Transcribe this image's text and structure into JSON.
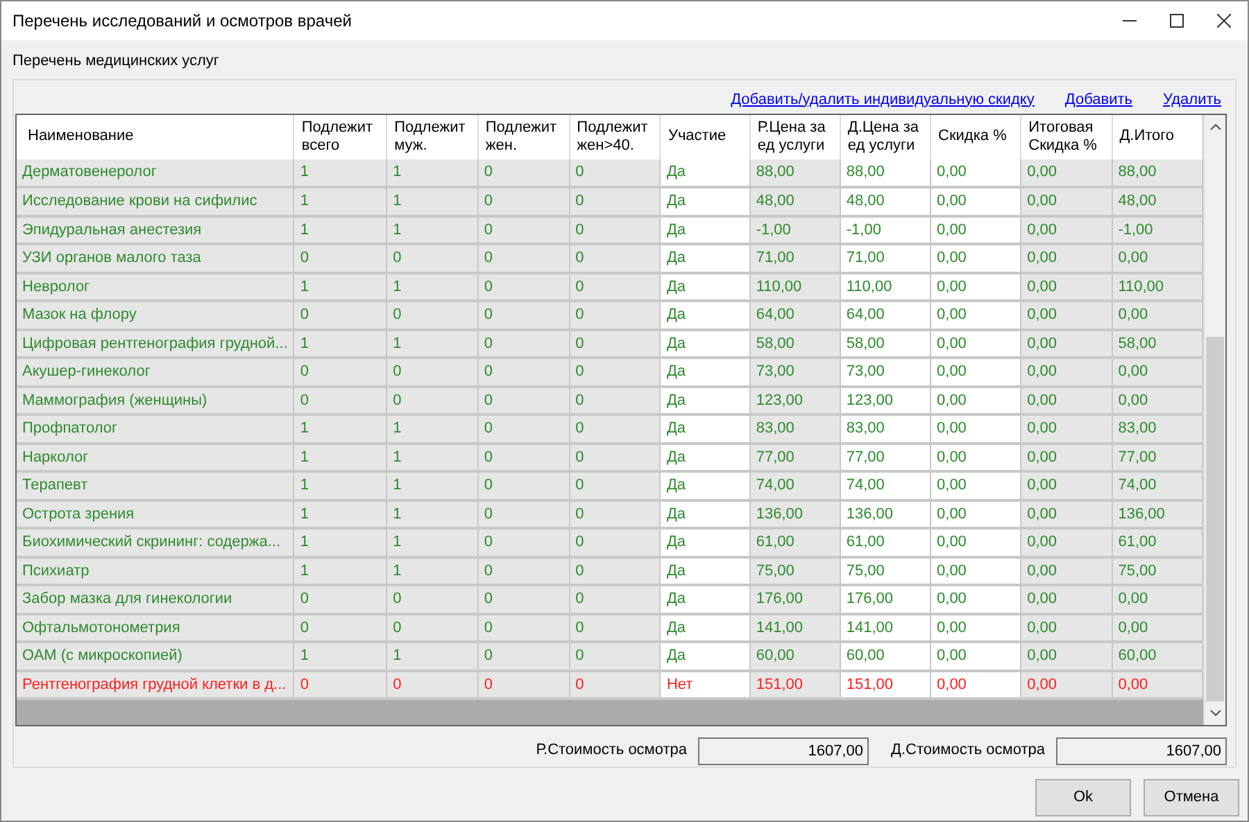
{
  "window": {
    "title": "Перечень исследований и осмотров врачей"
  },
  "section_label": "Перечень медицинских услуг",
  "links": [
    "Добавить/удалить индивидуальную скидку",
    "Добавить",
    "Удалить"
  ],
  "table": {
    "columns": [
      {
        "label": "Наименование",
        "editable": false
      },
      {
        "label": "Подлежит всего",
        "editable": false
      },
      {
        "label": "Подлежит муж.",
        "editable": false
      },
      {
        "label": "Подлежит жен.",
        "editable": false
      },
      {
        "label": "Подлежит жен>40.",
        "editable": false
      },
      {
        "label": "Участие",
        "editable": true
      },
      {
        "label": "Р.Цена за ед услуги",
        "editable": false
      },
      {
        "label": "Д.Цена за ед услуги",
        "editable": true
      },
      {
        "label": "Скидка %",
        "editable": true
      },
      {
        "label": "Итоговая Скидка %",
        "editable": false
      },
      {
        "label": "Д.Итого",
        "editable": false
      }
    ],
    "rows": [
      {
        "color": "#2e8b2e",
        "cells": [
          "Дерматовенеролог",
          "1",
          "1",
          "0",
          "0",
          "Да",
          "88,00",
          "88,00",
          "0,00",
          "0,00",
          "88,00"
        ]
      },
      {
        "color": "#2e8b2e",
        "cells": [
          "Исследование крови на сифилис",
          "1",
          "1",
          "0",
          "0",
          "Да",
          "48,00",
          "48,00",
          "0,00",
          "0,00",
          "48,00"
        ]
      },
      {
        "color": "#2e8b2e",
        "cells": [
          "Эпидуральная анестезия",
          "1",
          "1",
          "0",
          "0",
          "Да",
          "-1,00",
          "-1,00",
          "0,00",
          "0,00",
          "-1,00"
        ]
      },
      {
        "color": "#2e8b2e",
        "cells": [
          "УЗИ органов малого таза",
          "0",
          "0",
          "0",
          "0",
          "Да",
          "71,00",
          "71,00",
          "0,00",
          "0,00",
          "0,00"
        ]
      },
      {
        "color": "#2e8b2e",
        "cells": [
          "Невролог",
          "1",
          "1",
          "0",
          "0",
          "Да",
          "110,00",
          "110,00",
          "0,00",
          "0,00",
          "110,00"
        ]
      },
      {
        "color": "#2e8b2e",
        "cells": [
          "Мазок на флору",
          "0",
          "0",
          "0",
          "0",
          "Да",
          "64,00",
          "64,00",
          "0,00",
          "0,00",
          "0,00"
        ]
      },
      {
        "color": "#2e8b2e",
        "cells": [
          "Цифровая рентгенография грудной...",
          "1",
          "1",
          "0",
          "0",
          "Да",
          "58,00",
          "58,00",
          "0,00",
          "0,00",
          "58,00"
        ]
      },
      {
        "color": "#2e8b2e",
        "cells": [
          "Акушер-гинеколог",
          "0",
          "0",
          "0",
          "0",
          "Да",
          "73,00",
          "73,00",
          "0,00",
          "0,00",
          "0,00"
        ]
      },
      {
        "color": "#2e8b2e",
        "cells": [
          "Маммография (женщины)",
          "0",
          "0",
          "0",
          "0",
          "Да",
          "123,00",
          "123,00",
          "0,00",
          "0,00",
          "0,00"
        ]
      },
      {
        "color": "#2e8b2e",
        "cells": [
          "Профпатолог",
          "1",
          "1",
          "0",
          "0",
          "Да",
          "83,00",
          "83,00",
          "0,00",
          "0,00",
          "83,00"
        ]
      },
      {
        "color": "#2e8b2e",
        "cells": [
          "Нарколог",
          "1",
          "1",
          "0",
          "0",
          "Да",
          "77,00",
          "77,00",
          "0,00",
          "0,00",
          "77,00"
        ]
      },
      {
        "color": "#2e8b2e",
        "cells": [
          "Терапевт",
          "1",
          "1",
          "0",
          "0",
          "Да",
          "74,00",
          "74,00",
          "0,00",
          "0,00",
          "74,00"
        ]
      },
      {
        "color": "#2e8b2e",
        "cells": [
          "Острота зрения",
          "1",
          "1",
          "0",
          "0",
          "Да",
          "136,00",
          "136,00",
          "0,00",
          "0,00",
          "136,00"
        ]
      },
      {
        "color": "#2e8b2e",
        "cells": [
          "Биохимический скрининг: содержа...",
          "1",
          "1",
          "0",
          "0",
          "Да",
          "61,00",
          "61,00",
          "0,00",
          "0,00",
          "61,00"
        ]
      },
      {
        "color": "#2e8b2e",
        "cells": [
          "Психиатр",
          "1",
          "1",
          "0",
          "0",
          "Да",
          "75,00",
          "75,00",
          "0,00",
          "0,00",
          "75,00"
        ]
      },
      {
        "color": "#2e8b2e",
        "cells": [
          "Забор мазка для гинекологии",
          "0",
          "0",
          "0",
          "0",
          "Да",
          "176,00",
          "176,00",
          "0,00",
          "0,00",
          "0,00"
        ]
      },
      {
        "color": "#2e8b2e",
        "cells": [
          "Офтальмотонометрия",
          "0",
          "0",
          "0",
          "0",
          "Да",
          "141,00",
          "141,00",
          "0,00",
          "0,00",
          "0,00"
        ]
      },
      {
        "color": "#2e8b2e",
        "cells": [
          "ОАМ (с микроскопией)",
          "1",
          "1",
          "0",
          "0",
          "Да",
          "60,00",
          "60,00",
          "0,00",
          "0,00",
          "60,00"
        ]
      },
      {
        "color": "#ff2020",
        "cells": [
          "Рентгенография грудной клетки в д...",
          "0",
          "0",
          "0",
          "0",
          "Нет",
          "151,00",
          "151,00",
          "0,00",
          "0,00",
          "0,00"
        ]
      }
    ]
  },
  "totals": [
    {
      "label": "Р.Стоимость осмотра",
      "value": "1607,00"
    },
    {
      "label": "Д.Стоимость осмотра",
      "value": "1607,00"
    }
  ],
  "buttons": [
    "Ok",
    "Отмена"
  ]
}
